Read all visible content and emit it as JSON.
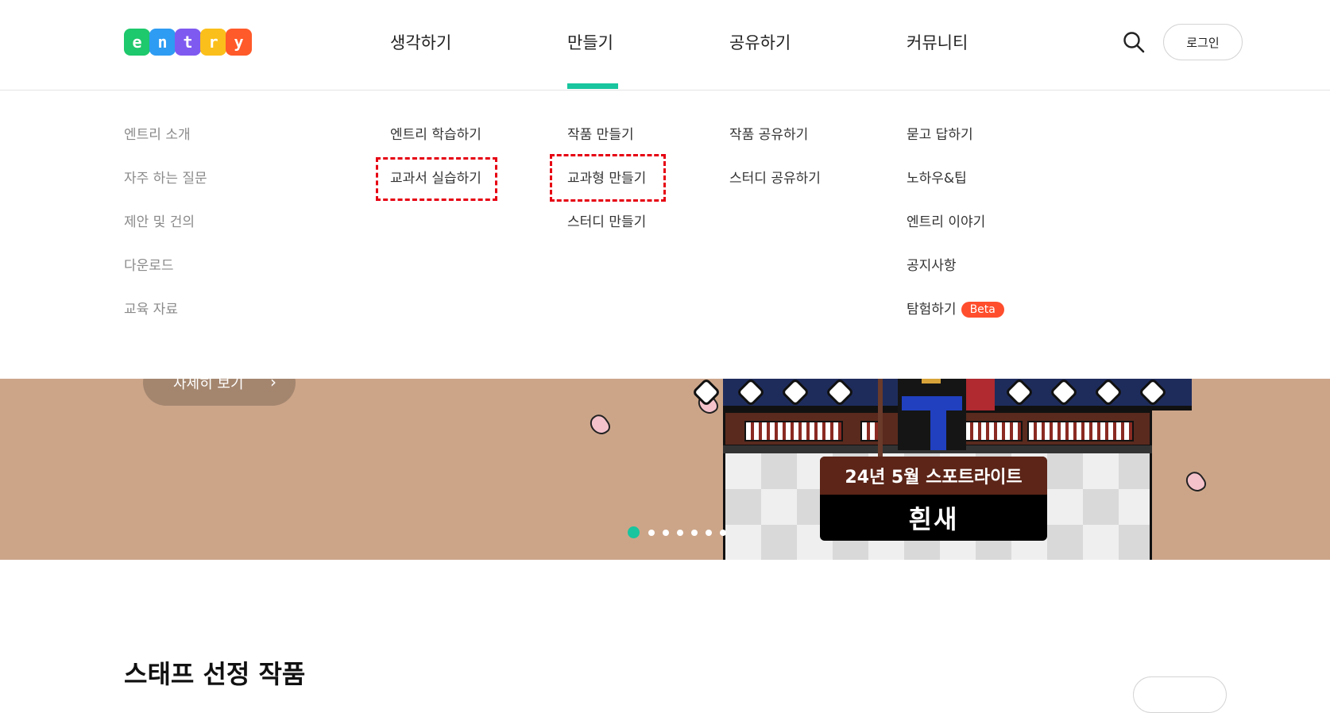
{
  "header": {
    "logo_letters": [
      {
        "char": "e",
        "color": "#1ec86c"
      },
      {
        "char": "n",
        "color": "#2e9cf2"
      },
      {
        "char": "t",
        "color": "#7f5af0"
      },
      {
        "char": "r",
        "color": "#fbbf1b"
      },
      {
        "char": "y",
        "color": "#ff5a2a"
      }
    ],
    "nav": [
      "생각하기",
      "만들기",
      "공유하기",
      "커뮤니티"
    ],
    "active_nav": "만들기",
    "login_label": "로그인",
    "search_icon": "search-icon"
  },
  "menu": {
    "intro": [
      "엔트리 소개",
      "자주 하는 질문",
      "제안 및 건의",
      "다운로드",
      "교육 자료"
    ],
    "think": [
      "엔트리 학습하기",
      "교과서 실습하기"
    ],
    "make": [
      "작품 만들기",
      "교과형 만들기",
      "스터디 만들기"
    ],
    "share": [
      "작품 공유하기",
      "스터디 공유하기"
    ],
    "community": [
      "묻고 답하기",
      "노하우&팁",
      "엔트리 이야기",
      "공지사항",
      "탐험하기"
    ],
    "beta_badge": "Beta"
  },
  "banner": {
    "detail_label": "자세히 보기",
    "detail_chevron": "chevron-right-icon",
    "sign_top": "24년 5월 스포트라이트",
    "sign_bottom": "흰새",
    "dots_count": 7,
    "active_dot": 0,
    "bg_color": "#cca589"
  },
  "section": {
    "title": "스태프 선정 작품"
  },
  "colors": {
    "accent": "#18c59e",
    "beta": "#ff4e2d",
    "highlight": "#e60012"
  }
}
